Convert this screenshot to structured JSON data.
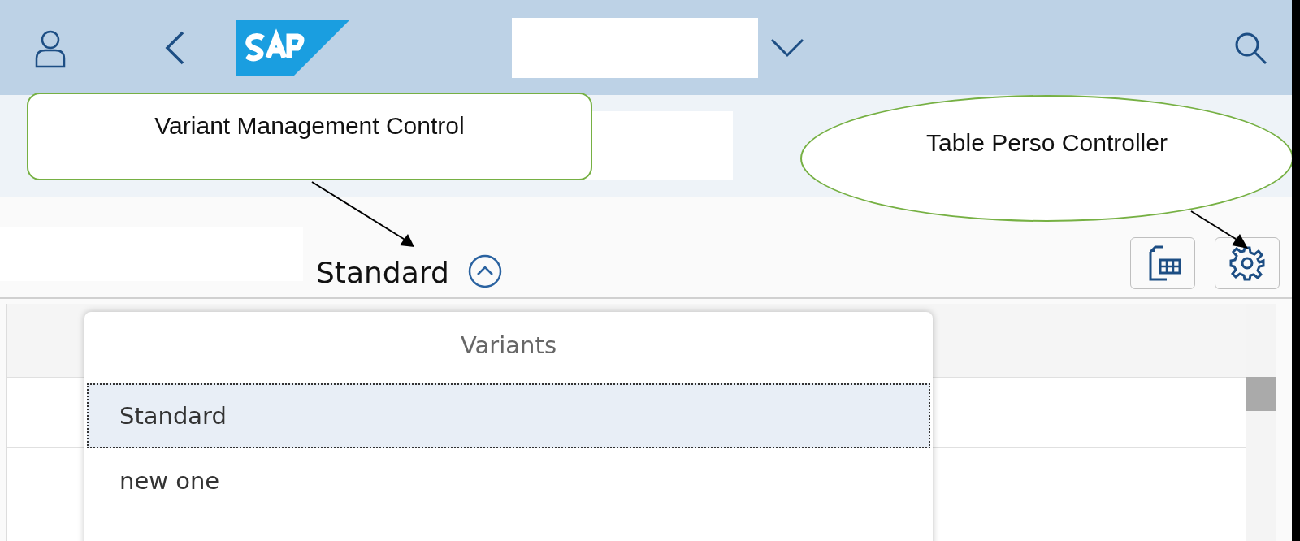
{
  "variant_management": {
    "title": "Standard",
    "expanded": true
  },
  "variants_popover": {
    "title": "Variants",
    "items": [
      {
        "label": "Standard",
        "selected": true
      },
      {
        "label": "new one",
        "selected": false
      }
    ]
  },
  "callouts": [
    {
      "kind": "box",
      "text": "Variant Management Control"
    },
    {
      "kind": "ellipse",
      "text": "Table Perso Controller"
    }
  ]
}
